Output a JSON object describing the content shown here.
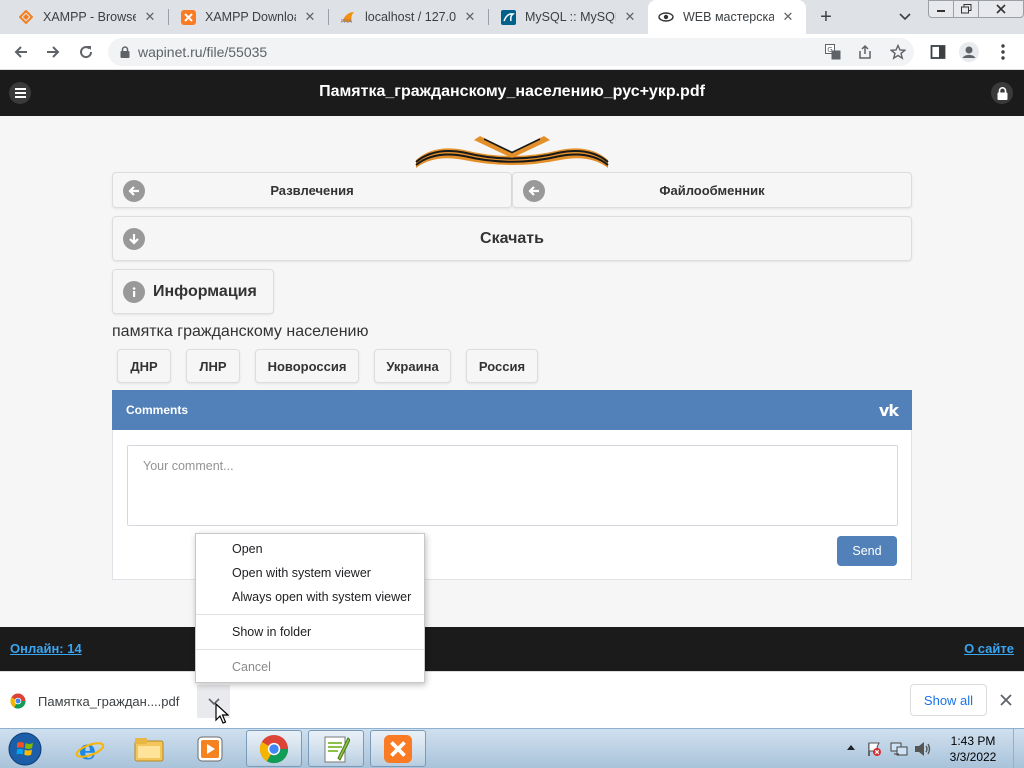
{
  "browser": {
    "tabs": [
      {
        "title": "XAMPP - Browse",
        "favicon": "xampp-orange-diamond-icon",
        "active": false
      },
      {
        "title": "XAMPP Download",
        "favicon": "xampp-icon",
        "active": false
      },
      {
        "title": "localhost / 127.0.",
        "favicon": "phpmyadmin-icon",
        "active": false
      },
      {
        "title": "MySQL :: MySQL",
        "favicon": "mysql-icon",
        "active": false
      },
      {
        "title": "WEB мастерская",
        "favicon": "web-workshop-icon",
        "active": true
      }
    ],
    "new_tab_label": "+",
    "url": "wapinet.ru/file/55035"
  },
  "site": {
    "title": "Памятка_гражданскому_населению_рус+укр.pdf",
    "nav_left": "Развлечения",
    "nav_right": "Файлообменник",
    "download_label": "Скачать",
    "info_label": "Информация",
    "description": "памятка гражданскому населению",
    "tags": [
      "ДНР",
      "ЛНР",
      "Новороссия",
      "Украина",
      "Россия"
    ]
  },
  "comments_widget": {
    "title": "Comments",
    "logo": "vk",
    "placeholder": "Your comment...",
    "send_label": "Send",
    "header_color": "#5181b8"
  },
  "footer": {
    "online_label": "Онлайн: 14",
    "about_label": "О сайте"
  },
  "context_menu": {
    "items": [
      "Open",
      "Open with system viewer",
      "Always open with system viewer"
    ],
    "folder_item": "Show in folder",
    "cancel_item": "Cancel"
  },
  "download_shelf": {
    "file_name": "Памятка_граждан....pdf",
    "show_all_label": "Show all"
  },
  "taskbar": {
    "time": "1:43 PM",
    "date": "3/3/2022",
    "apps": [
      "internet-explorer-icon",
      "file-explorer-icon",
      "media-player-icon",
      "chrome-icon",
      "notepad-plus-plus-icon",
      "xampp-icon"
    ]
  }
}
